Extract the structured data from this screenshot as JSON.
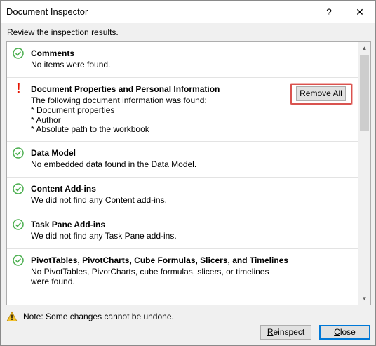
{
  "window": {
    "title": "Document Inspector",
    "help_label": "?",
    "close_label": "✕"
  },
  "subtitle": "Review the inspection results.",
  "results": [
    {
      "status": "ok",
      "title": "Comments",
      "description": "No items were found."
    },
    {
      "status": "warning",
      "title": "Document Properties and Personal Information",
      "description": "The following document information was found:",
      "details": [
        "* Document properties",
        "* Author",
        "* Absolute path to the workbook"
      ],
      "action_label": "Remove All"
    },
    {
      "status": "ok",
      "title": "Data Model",
      "description": "No embedded data found in the Data Model."
    },
    {
      "status": "ok",
      "title": "Content Add-ins",
      "description": "We did not find any Content add-ins."
    },
    {
      "status": "ok",
      "title": "Task Pane Add-ins",
      "description": "We did not find any Task Pane add-ins."
    },
    {
      "status": "ok",
      "title": "PivotTables, PivotCharts, Cube Formulas, Slicers, and Timelines",
      "description": "No PivotTables, PivotCharts, cube formulas, slicers, or timelines were found."
    }
  ],
  "note": "Note: Some changes cannot be undone.",
  "buttons": {
    "reinspect_first": "R",
    "reinspect_rest": "einspect",
    "close_first": "C",
    "close_rest": "lose"
  },
  "colors": {
    "ok_green": "#4caf50",
    "warning_red": "#e51400",
    "highlight_box": "#d9534f",
    "default_button_border": "#0078d7"
  }
}
